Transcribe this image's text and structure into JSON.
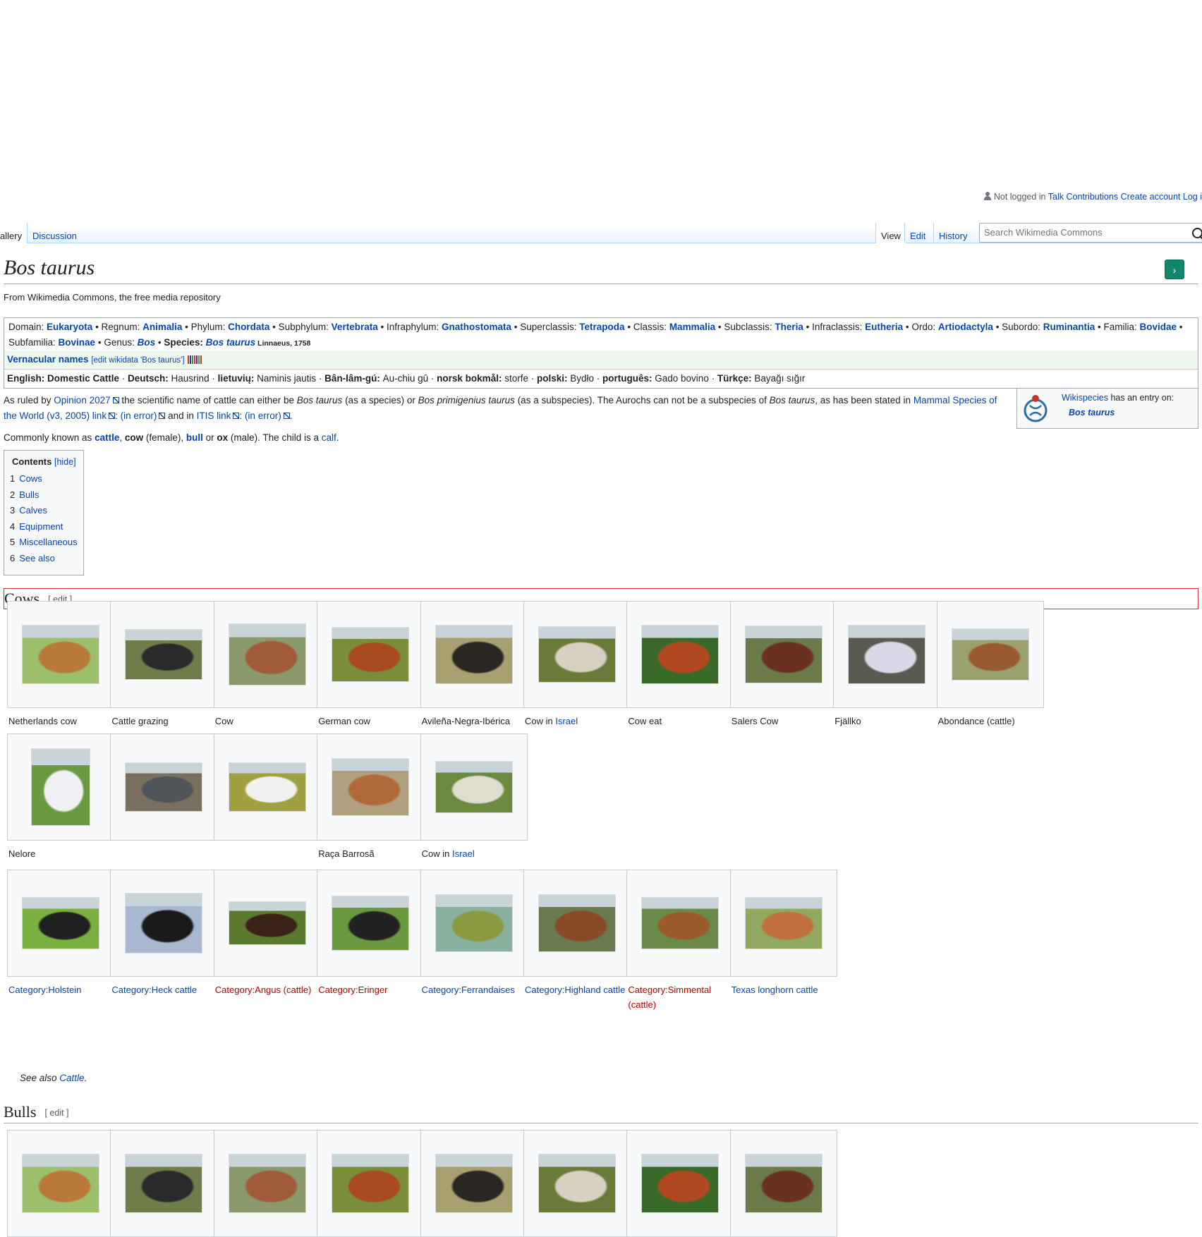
{
  "personal_tools": {
    "not_logged_in": "Not logged in",
    "talk": "Talk",
    "contributions": "Contributions",
    "create_account": "Create account",
    "log_in": "Log i"
  },
  "tabs": {
    "gallery": "allery",
    "discussion": "Discussion",
    "view": "View",
    "edit": "Edit",
    "history": "History"
  },
  "search": {
    "placeholder": "Search Wikimedia Commons"
  },
  "page": {
    "title": "Bos taurus",
    "green_button": "›",
    "sitesub": "From Wikimedia Commons, the free media repository"
  },
  "taxonomy": [
    {
      "rank": "Domain:",
      "name": "Eukaryota"
    },
    {
      "rank": "Regnum:",
      "name": "Animalia"
    },
    {
      "rank": "Phylum:",
      "name": "Chordata"
    },
    {
      "rank": "Subphylum:",
      "name": "Vertebrata"
    },
    {
      "rank": "Infraphylum:",
      "name": "Gnathostomata"
    },
    {
      "rank": "Superclassis:",
      "name": "Tetrapoda"
    },
    {
      "rank": "Classis:",
      "name": "Mammalia"
    },
    {
      "rank": "Subclassis:",
      "name": "Theria"
    },
    {
      "rank": "Infraclassis:",
      "name": "Eutheria"
    },
    {
      "rank": "Ordo:",
      "name": "Artiodactyla"
    },
    {
      "rank": "Subordo:",
      "name": "Ruminantia"
    },
    {
      "rank": "Familia:",
      "name": "Bovidae"
    },
    {
      "rank": "Subfamilia:",
      "name": "Bovinae"
    },
    {
      "rank": "Genus:",
      "name": "Bos"
    }
  ],
  "species": {
    "label": "Species:",
    "name": "Bos taurus",
    "authority": "Linnaeus, 1758"
  },
  "vernacular": {
    "title": "Vernacular names",
    "edit_link": "[edit wikidata 'Bos taurus']",
    "names": [
      {
        "lang": "English:",
        "name": "Domestic Cattle",
        "bold": true
      },
      {
        "lang": "Deutsch:",
        "name": "Hausrind"
      },
      {
        "lang": "lietuvių:",
        "name": "Naminis jautis"
      },
      {
        "lang": "Bân-lâm-gú:",
        "name": "Au-chiu gû"
      },
      {
        "lang": "norsk bokmål:",
        "name": "storfe"
      },
      {
        "lang": "polski:",
        "name": "Bydło"
      },
      {
        "lang": "português:",
        "name": "Gado bovino"
      },
      {
        "lang": "Türkçe:",
        "name": "Bayağı sığır"
      }
    ]
  },
  "intro": {
    "t1": "As ruled by ",
    "opinion": "Opinion 2027",
    "t2": " the scientific name of cattle can either be ",
    "bos_taurus": "Bos taurus",
    "t3": " (as a species) or ",
    "bos_prim": "Bos primigenius taurus",
    "t4": " (as a subspecies). The Aurochs can not be a subspecies of ",
    "bos_taurus2": "Bos taurus",
    "t5": ", as has been stated in ",
    "msw": "Mammal Species of the World (v3, 2005) link",
    "t6": ": ",
    "in_error": "(in error)",
    "t7": " and in ",
    "itis": "ITIS link",
    "t8": ": ",
    "in_error2": "(in error)",
    "t9": "."
  },
  "common": {
    "t1": "Commonly known as ",
    "cattle": "cattle",
    "t2": ", ",
    "cow": "cow",
    "t3": " (female), ",
    "bull": "bull",
    "t4": " or ",
    "ox": "ox",
    "t5": " (male). The child is a ",
    "calf": "calf",
    "t6": "."
  },
  "wikispecies": {
    "link": "Wikispecies",
    "text": " has an entry on:",
    "entry": "Bos taurus"
  },
  "toc": {
    "title": "Contents",
    "hide": "[hide]",
    "items": [
      {
        "num": "1",
        "label": "Cows"
      },
      {
        "num": "2",
        "label": "Bulls"
      },
      {
        "num": "3",
        "label": "Calves"
      },
      {
        "num": "4",
        "label": "Equipment"
      },
      {
        "num": "5",
        "label": "Miscellaneous"
      },
      {
        "num": "6",
        "label": "See also"
      }
    ]
  },
  "sections": {
    "cows": "Cows",
    "bulls": "Bulls",
    "edit": "[ edit ]"
  },
  "gallery_row1": [
    {
      "caption": "Netherlands cow"
    },
    {
      "caption": "Cattle grazing"
    },
    {
      "caption": "Cow"
    },
    {
      "caption": "German cow"
    },
    {
      "caption": "Avileña-Negra-Ibérica"
    },
    {
      "caption": "Cow in ",
      "link": "Israel"
    },
    {
      "caption": "Cow eat"
    },
    {
      "caption": "Salers Cow"
    },
    {
      "caption": "Fjällko"
    },
    {
      "caption": "Abondance (cattle)"
    }
  ],
  "gallery_row2": [
    {
      "caption": "Nelore"
    },
    {
      "caption": ""
    },
    {
      "caption": ""
    },
    {
      "caption": "Raça Barrosã"
    },
    {
      "caption": "Cow in ",
      "link": "Israel"
    }
  ],
  "gallery_row3": [
    {
      "link": "Category:Holstein",
      "red": false
    },
    {
      "link": "Category:Heck cattle",
      "red": false
    },
    {
      "link": "Category:Angus (cattle)",
      "red": true
    },
    {
      "link": "Category:Eringer",
      "red": true
    },
    {
      "link": "Category:Ferrandaises",
      "red": false
    },
    {
      "link": "Category:Highland cattle",
      "red": false
    },
    {
      "link": "Category:Simmental (cattle)",
      "red": true
    },
    {
      "link": "Texas longhorn cattle",
      "red": false
    }
  ],
  "see_also": {
    "text": "See also ",
    "link": "Cattle",
    "end": "."
  },
  "colors": {
    "link": "#0645ad",
    "redlink": "#ba0000",
    "border": "#a2a9b1",
    "accent_green": "#14866d"
  }
}
